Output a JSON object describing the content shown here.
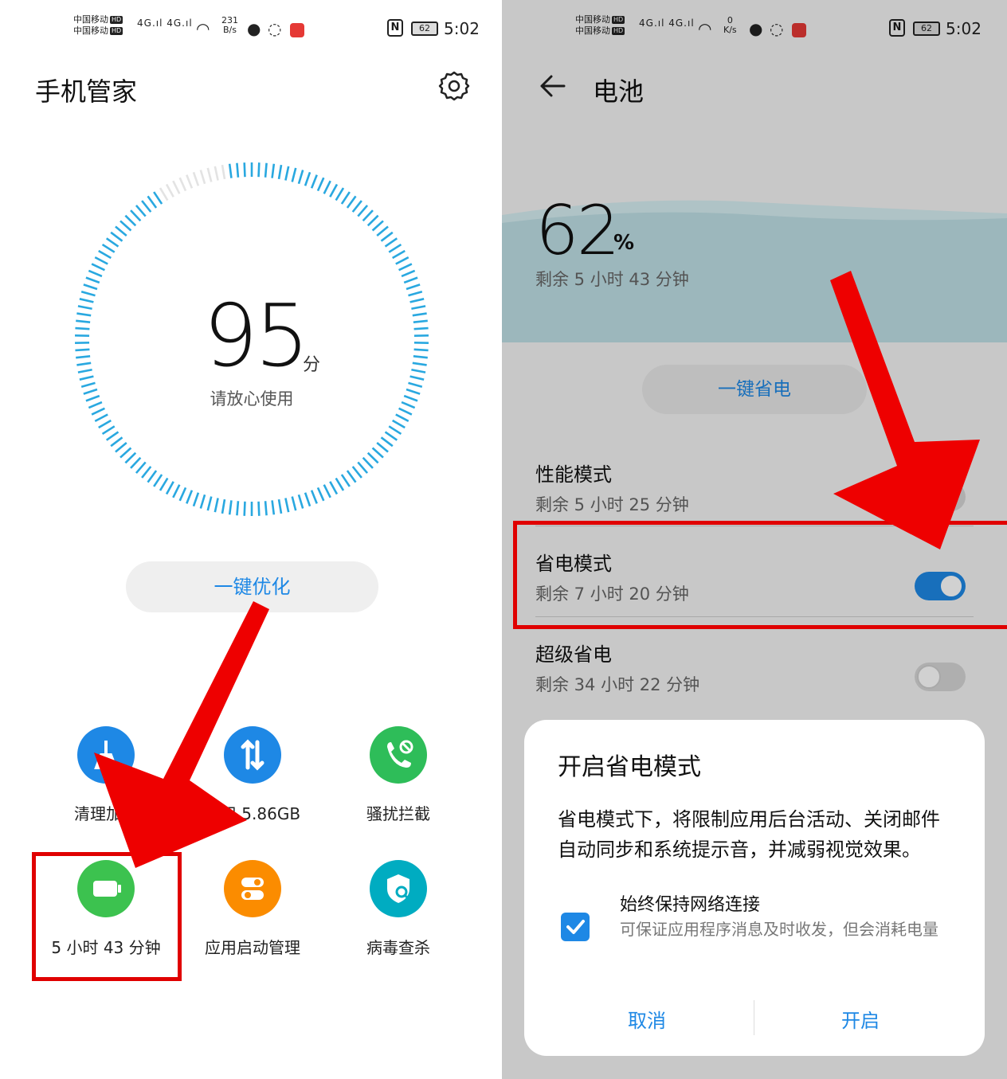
{
  "status_bar": {
    "carrier_1": "中国移动",
    "carrier_2": "中国移动",
    "hd": "HD",
    "left_speed_value": "231",
    "left_speed_unit": "B/s",
    "right_speed_value": "0",
    "right_speed_unit": "K/s",
    "battery_level": "62",
    "time": "5:02",
    "network_type": "4G"
  },
  "left": {
    "title": "手机管家",
    "score": "95",
    "score_unit": "分",
    "score_subtitle": "请放心使用",
    "optimize_label": "一键优化",
    "tiles": [
      {
        "label": "清理加速",
        "color": "#1e88e5",
        "icon": "broom-icon"
      },
      {
        "label": "已用 5.86GB",
        "color": "#1e88e5",
        "icon": "data-transfer-icon"
      },
      {
        "label": "骚扰拦截",
        "color": "#2ebd59",
        "icon": "phone-block-icon"
      },
      {
        "label": "5 小时 43 分钟",
        "color": "#3cc24f",
        "icon": "battery-icon"
      },
      {
        "label": "应用启动管理",
        "color": "#fb8c00",
        "icon": "toggle-icon"
      },
      {
        "label": "病毒查杀",
        "color": "#00acc1",
        "icon": "shield-search-icon"
      }
    ]
  },
  "right": {
    "title": "电池",
    "percent": "62",
    "percent_unit": "%",
    "remaining": "剩余 5 小时 43 分钟",
    "save_button": "一键省电",
    "modes": [
      {
        "name": "性能模式",
        "remaining": "剩余 5 小时 25 分钟",
        "on": false
      },
      {
        "name": "省电模式",
        "remaining": "剩余 7 小时 20 分钟",
        "on": true
      },
      {
        "name": "超级省电",
        "remaining": "剩余 34 小时 22 分钟",
        "on": false
      }
    ],
    "dialog": {
      "title": "开启省电模式",
      "body": "省电模式下，将限制应用后台活动、关闭邮件自动同步和系统提示音，并减弱视觉效果。",
      "checkbox_title": "始终保持网络连接",
      "checkbox_sub": "可保证应用程序消息及时收发，但会消耗电量",
      "checkbox_checked": true,
      "cancel": "取消",
      "confirm": "开启"
    }
  },
  "colors": {
    "accent": "#1e88e5",
    "annotation_red": "#e00000",
    "gauge_tick": "#29a8e0",
    "wave": "#9dc1c9"
  }
}
